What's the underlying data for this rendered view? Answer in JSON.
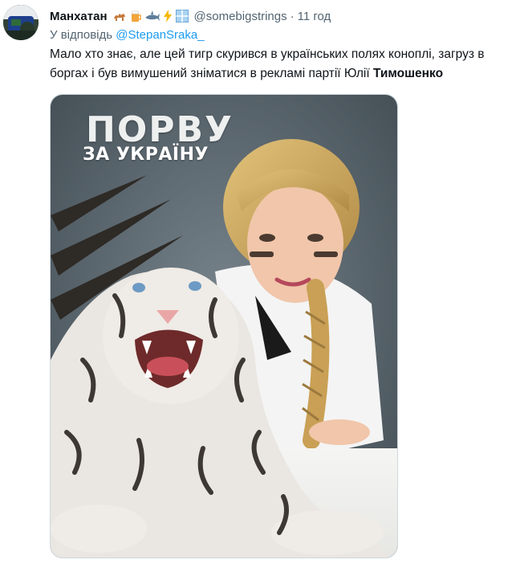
{
  "tweet": {
    "display_name": "Манхатан",
    "name_emojis": [
      "camel-emoji",
      "beer-emoji",
      "shark-emoji",
      "lightning-emoji",
      "window-emoji"
    ],
    "handle": "@somebigstrings",
    "separator": "·",
    "time": "11 год",
    "reply_prefix": "У відповідь",
    "reply_to": "@StepanSraka_",
    "text_main": "Мало хто знає, але цей тигр скурився в українських полях коноплі, загруз в боргах і був вимушений зніматися в рекламі партії Юлії ",
    "text_bold": "Тимошенко"
  },
  "poster": {
    "title": "ПОРВУ",
    "subtitle": "ЗА УКРАЇНУ"
  },
  "colors": {
    "link": "#1d9bf0",
    "secondary_text": "#536471",
    "poster_bg": "#5b6870"
  }
}
